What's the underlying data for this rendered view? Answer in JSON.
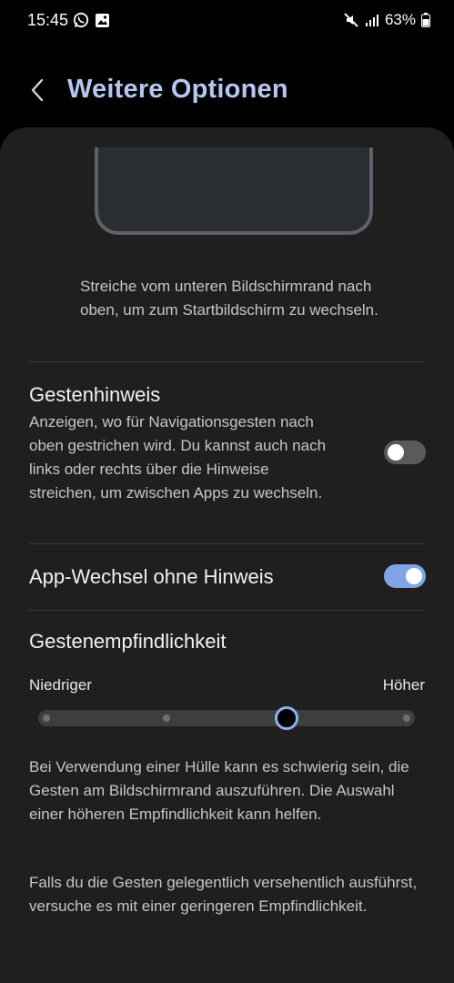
{
  "status_bar": {
    "time": "15:45",
    "battery": "63%",
    "icons": [
      "whatsapp-icon",
      "gallery-icon",
      "mute-icon",
      "signal-icon",
      "battery-icon"
    ]
  },
  "header": {
    "title": "Weitere Optionen",
    "back_icon": "chevron-left-icon"
  },
  "swipe_section": {
    "cut_label": "streichen",
    "description": "Streiche vom unteren Bildschirmrand nach oben, um zum Startbildschirm zu wechseln."
  },
  "gesture_hint": {
    "title": "Gestenhinweis",
    "description": "Anzeigen, wo für Navigationsgesten nach oben gestrichen wird. Du kannst auch nach links oder rechts über die Hinweise streichen, um zwischen Apps zu wechseln.",
    "enabled": false
  },
  "app_switch": {
    "title": "App-Wechsel ohne Hinweis",
    "enabled": true
  },
  "sensitivity": {
    "title": "Gestenempfindlichkeit",
    "min_label": "Niedriger",
    "max_label": "Höher",
    "steps": 4,
    "value": 3
  },
  "info": {
    "paragraph1": "Bei Verwendung einer Hülle kann es schwierig sein, die Gesten am Bildschirmrand auszuführen. Die Auswahl einer höheren Empfindlichkeit kann helfen.",
    "paragraph2": "Falls du die Gesten gelegentlich versehentlich ausführst, versuche es mit einer geringeren Empfindlichkeit."
  },
  "colors": {
    "accent": "#7fa4e8",
    "title": "#b7c7f0",
    "card": "#1f1f1f",
    "background": "#000000"
  }
}
